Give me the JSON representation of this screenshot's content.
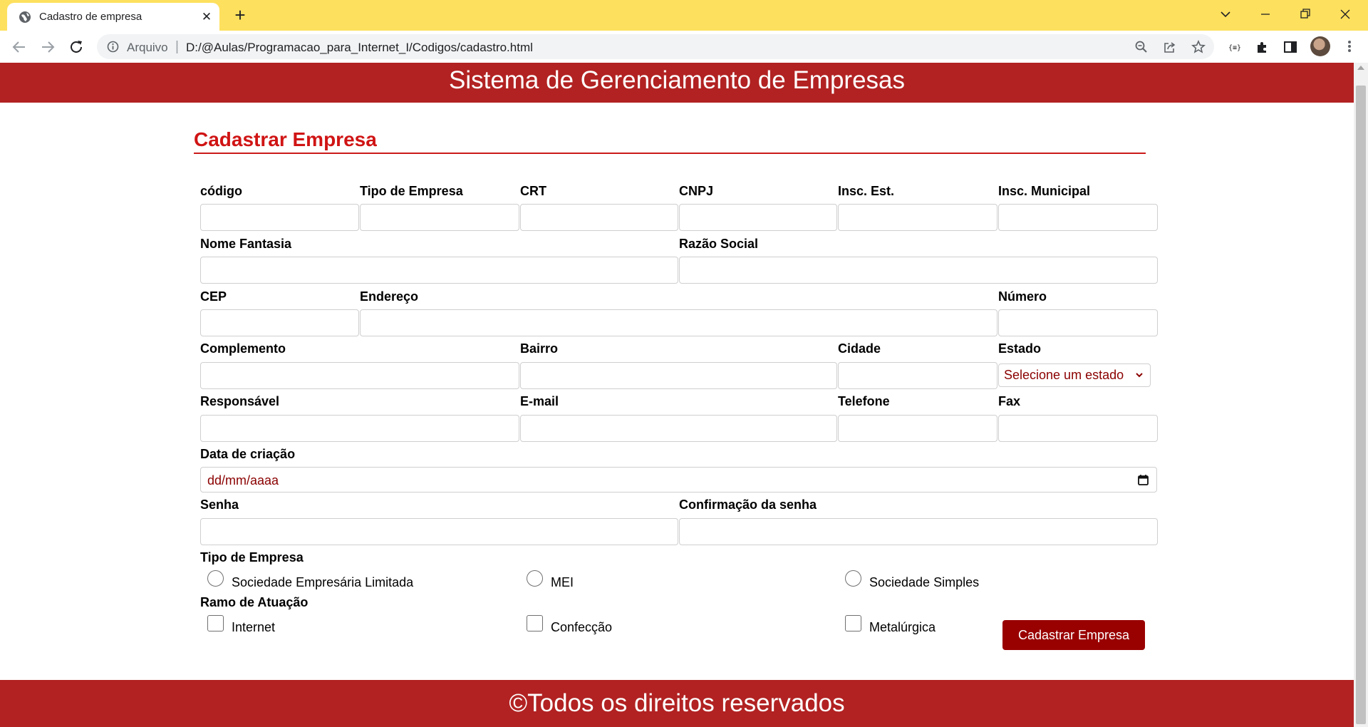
{
  "browser": {
    "tab_title": "Cadastro de empresa",
    "tab_close": "✕",
    "new_tab": "+",
    "address_scheme": "Arquivo",
    "address_separator": "|",
    "address_url": "D:/@Aulas/Programacao_para_Internet_I/Codigos/cadastro.html",
    "accent_color": "#fde05e"
  },
  "page": {
    "header_title": "Sistema de Gerenciamento de Empresas",
    "footer_text": "©Todos os direitos reservados",
    "brand_color": "#b22222"
  },
  "form": {
    "title": "Cadastrar Empresa",
    "labels": {
      "codigo": "código",
      "tipo_empresa": "Tipo de Empresa",
      "crt": "CRT",
      "cnpj": "CNPJ",
      "insc_est": "Insc. Est.",
      "insc_municipal": "Insc. Municipal",
      "nome_fantasia": "Nome Fantasia",
      "razao_social": "Razão Social",
      "cep": "CEP",
      "endereco": "Endereço",
      "numero": "Número",
      "complemento": "Complemento",
      "bairro": "Bairro",
      "cidade": "Cidade",
      "estado": "Estado",
      "responsavel": "Responsável",
      "email": "E-mail",
      "telefone": "Telefone",
      "fax": "Fax",
      "data_criacao": "Data de criação",
      "senha": "Senha",
      "confirmacao_senha": "Confirmação da senha",
      "tipo_empresa_group": "Tipo de Empresa",
      "ramo_atuacao": "Ramo de Atuação"
    },
    "estado_selected": "Selecione um estado",
    "data_placeholder": "dd/mm/aaaa",
    "tipo_options": [
      "Sociedade Empresária Limitada",
      "MEI",
      "Sociedade Simples"
    ],
    "ramo_options": [
      "Internet",
      "Confecção",
      "Metalúrgica"
    ],
    "submit_label": "Cadastrar Empresa"
  }
}
